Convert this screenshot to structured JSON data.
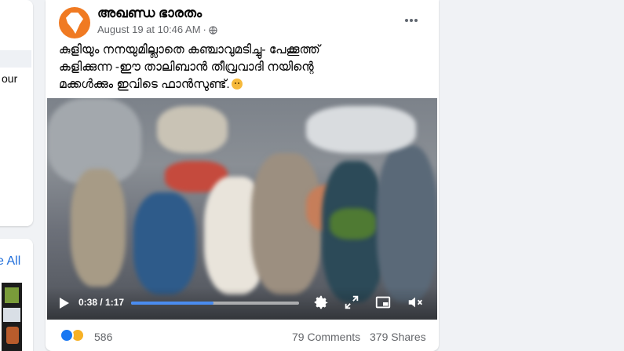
{
  "left_panel": {
    "partial_text": "our",
    "see_all_label": "e All"
  },
  "post": {
    "page_name": "അഖണ്ഡ ഭാരതം",
    "timestamp": "August 19 at 10:46 AM",
    "separator": "·",
    "caption_line1": "കുളിയും നനയുമില്ലാതെ കഞ്ചാവുമടിച്ചു- പേക്കൂത്ത്",
    "caption_line2": "കളിക്കുന്ന -ഈ താലിബാൻ തീവ്രവാദി നയിന്റെ",
    "caption_line3": "മക്കൾക്കും ഇവിടെ ഫാൻസുണ്ട്.",
    "video": {
      "time_display": "0:38 / 1:17",
      "progress": 0.49
    },
    "reactions_count": "586",
    "comments_label": "79 Comments",
    "shares_label": "379 Shares"
  },
  "colors": {
    "accent": "#1877f2",
    "progress": "#4a8cf0",
    "avatar": "#f07a22"
  }
}
